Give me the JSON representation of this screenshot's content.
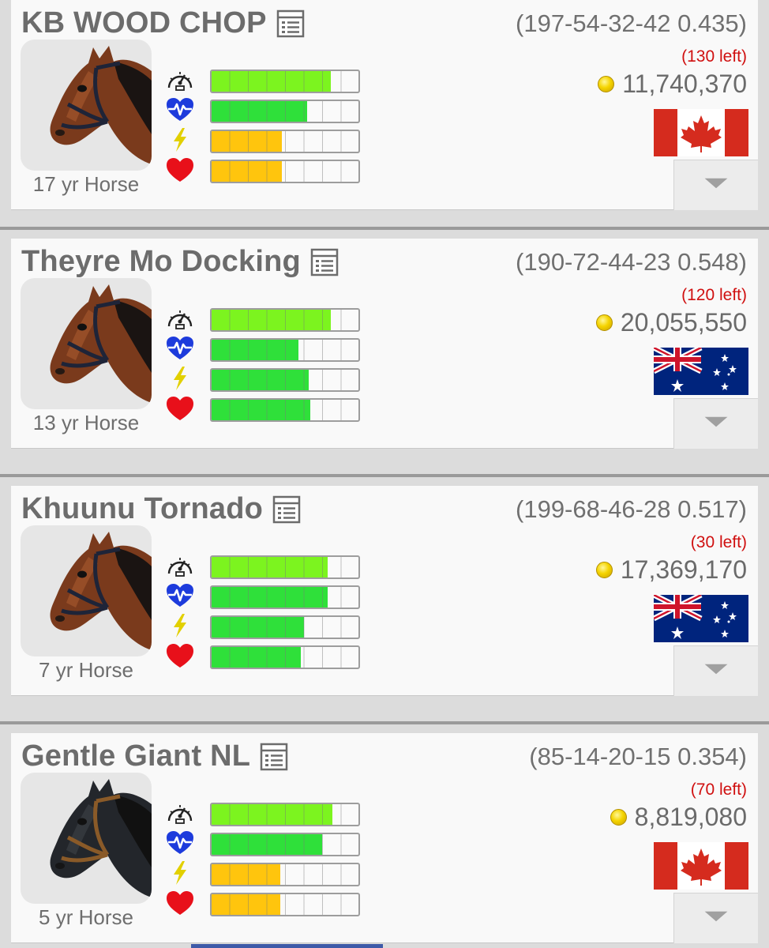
{
  "horses": [
    {
      "name": "KB WOOD CHOP",
      "record": "(197-54-32-42 0.435)",
      "races_left": "(130 left)",
      "earnings": "11,740,370",
      "age": "17 yr Horse",
      "country": "canada",
      "flag_icon": "canada-flag-icon",
      "coat": "bay",
      "stats": [
        {
          "name": "speed",
          "level": 0.81,
          "color": "lime"
        },
        {
          "name": "stamina",
          "level": 0.65,
          "color": "green"
        },
        {
          "name": "energy",
          "level": 0.48,
          "color": "orange"
        },
        {
          "name": "health",
          "level": 0.48,
          "color": "orange"
        }
      ]
    },
    {
      "name": "Theyre Mo Docking",
      "record": "(190-72-44-23 0.548)",
      "races_left": "(120 left)",
      "earnings": "20,055,550",
      "age": "13 yr Horse",
      "country": "australia",
      "flag_icon": "australia-flag-icon",
      "coat": "bay",
      "stats": [
        {
          "name": "speed",
          "level": 0.81,
          "color": "lime"
        },
        {
          "name": "stamina",
          "level": 0.59,
          "color": "green"
        },
        {
          "name": "energy",
          "level": 0.66,
          "color": "green"
        },
        {
          "name": "health",
          "level": 0.67,
          "color": "green"
        }
      ]
    },
    {
      "name": "Khuunu Tornado",
      "record": "(199-68-46-28 0.517)",
      "races_left": "(30 left)",
      "earnings": "17,369,170",
      "age": "7 yr Horse",
      "country": "australia",
      "flag_icon": "australia-flag-icon",
      "coat": "bay",
      "stats": [
        {
          "name": "speed",
          "level": 0.79,
          "color": "lime"
        },
        {
          "name": "stamina",
          "level": 0.79,
          "color": "green"
        },
        {
          "name": "energy",
          "level": 0.63,
          "color": "green"
        },
        {
          "name": "health",
          "level": 0.61,
          "color": "green"
        }
      ]
    },
    {
      "name": "Gentle Giant NL",
      "record": "(85-14-20-15 0.354)",
      "races_left": "(70 left)",
      "earnings": "8,819,080",
      "age": "5 yr Horse",
      "country": "canada",
      "flag_icon": "canada-flag-icon",
      "coat": "black",
      "stats": [
        {
          "name": "speed",
          "level": 0.82,
          "color": "lime"
        },
        {
          "name": "stamina",
          "level": 0.75,
          "color": "green"
        },
        {
          "name": "energy",
          "level": 0.47,
          "color": "orange"
        },
        {
          "name": "health",
          "level": 0.47,
          "color": "orange"
        }
      ]
    }
  ],
  "icons": {
    "speed": "speedometer-icon",
    "stamina": "heartbeat-icon",
    "energy": "lightning-icon",
    "health": "heart-icon",
    "details": "document-icon",
    "coin": "coin-icon",
    "expand": "chevron-down-icon"
  },
  "colors": {
    "lime": "#7cf41f",
    "green": "#2fe03a",
    "orange": "#ffc50d",
    "races_left": "#d01010",
    "name_text": "#6c6c6c",
    "background": "#dcdcdc"
  }
}
